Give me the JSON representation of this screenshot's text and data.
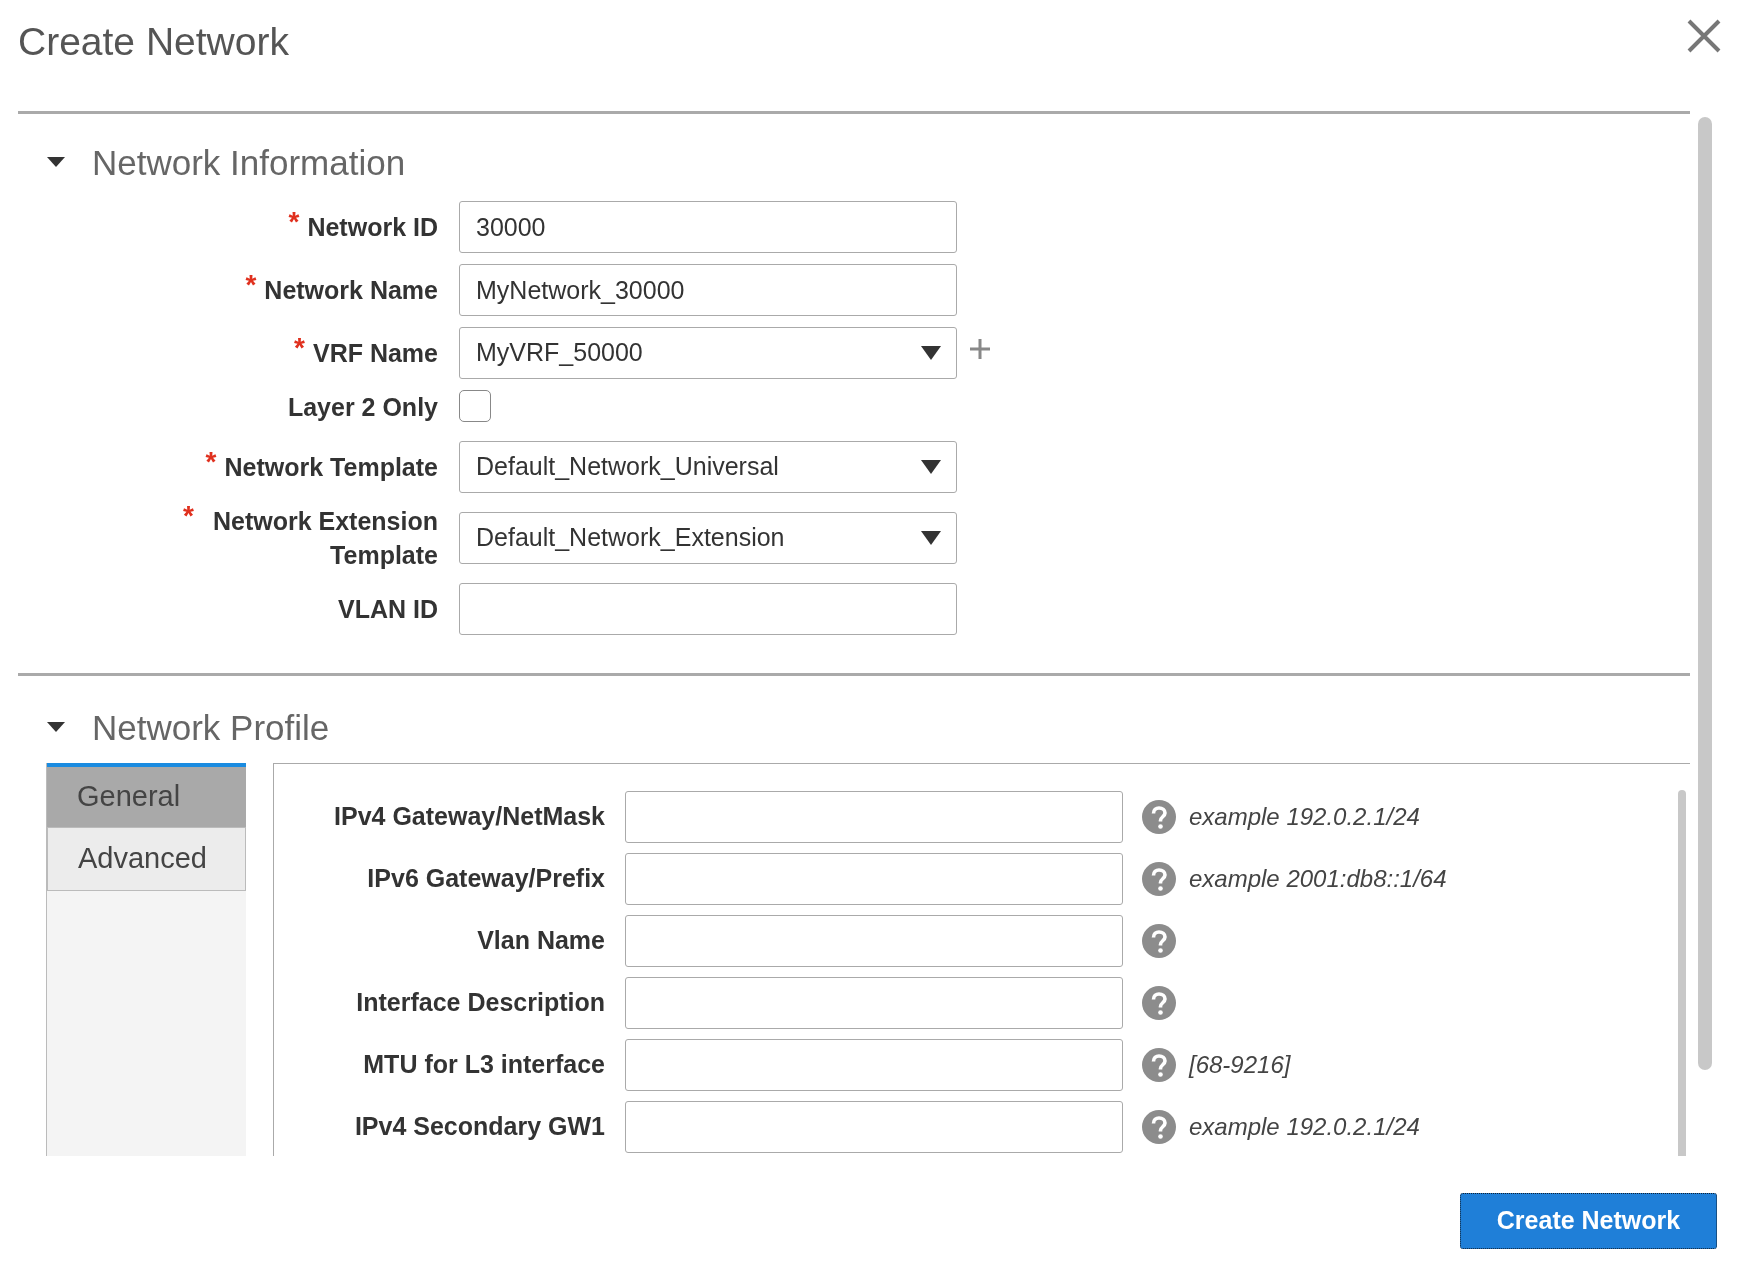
{
  "dialog": {
    "title": "Create Network"
  },
  "network_information": {
    "heading": "Network Information",
    "expanded": true,
    "fields": [
      {
        "kind": "text",
        "label": "Network ID",
        "required_mark": "*",
        "value": "30000"
      },
      {
        "kind": "text",
        "label": "Network Name",
        "required_mark": "*",
        "value": "MyNetwork_30000"
      },
      {
        "kind": "select",
        "label": "VRF Name",
        "required_mark": "*",
        "value": "MyVRF_50000",
        "add_button": true
      },
      {
        "kind": "checkbox",
        "label": "Layer 2 Only",
        "checked": false
      },
      {
        "kind": "select",
        "label": "Network Template",
        "required_mark": "*",
        "value": "Default_Network_Universal"
      },
      {
        "kind": "select",
        "label": "Network Extension Template",
        "required_mark": "*",
        "value": "Default_Network_Extension"
      },
      {
        "kind": "text",
        "label": "VLAN ID"
      }
    ]
  },
  "network_profile": {
    "heading": "Network Profile",
    "expanded": true,
    "tabs": [
      {
        "label": "General",
        "selected": true
      },
      {
        "label": "Advanced",
        "selected": false
      }
    ],
    "fields": [
      {
        "label": "IPv4 Gateway/NetMask",
        "hint": "example 192.0.2.1/24"
      },
      {
        "label": "IPv6 Gateway/Prefix",
        "hint": "example 2001:db8::1/64"
      },
      {
        "label": "Vlan Name"
      },
      {
        "label": "Interface Description"
      },
      {
        "label": "MTU for L3 interface",
        "hint": "[68-9216]"
      },
      {
        "label": "IPv4 Secondary GW1",
        "hint": "example 192.0.2.1/24"
      }
    ]
  },
  "footer": {
    "button": "Create Network"
  }
}
